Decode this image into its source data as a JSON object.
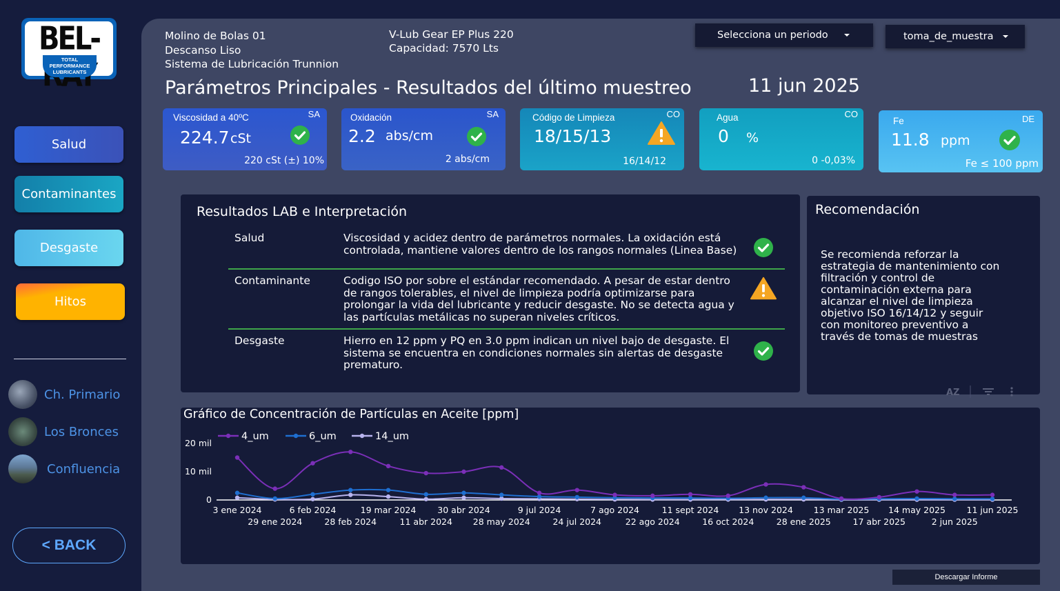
{
  "logo": {
    "brand": "BEL-RAY",
    "tagline_1": "TOTAL",
    "tagline_2": "PERFORMANCE",
    "tagline_3": "LUBRICANTS"
  },
  "sidebar": {
    "nav": [
      {
        "label": "Salud",
        "color": "#2f5fd2"
      },
      {
        "label": "Contaminantes",
        "color": "#1794b6"
      },
      {
        "label": "Desgaste",
        "color": "#5cc7ec"
      },
      {
        "label": "Hitos",
        "color": "#ffb300"
      }
    ],
    "sites": [
      {
        "label": "Ch. Primario"
      },
      {
        "label": "Los Bronces"
      },
      {
        "label": "Confluencia"
      }
    ],
    "back_label": "< BACK"
  },
  "header": {
    "equipment": "Molino de Bolas 01",
    "component": "Descanso Liso",
    "system": "Sistema de Lubricación Trunnion",
    "product": "V-Lub Gear EP Plus 220",
    "capacity": "Capacidad: 7570 Lts",
    "period_select": "Selecciona un periodo",
    "sample_select": "toma_de_muestra",
    "title": "Parámetros Principales - Resultados del último muestreo",
    "date": "11 jun 2025"
  },
  "kpis": [
    {
      "label": "Viscosidad a 40ºC",
      "tag": "SA",
      "value": "224.7",
      "unit": "cSt",
      "ref": "220 cSt (±) 10%",
      "status": "ok"
    },
    {
      "label": "Oxidación",
      "tag": "SA",
      "value": "2.2",
      "unit": "abs/cm",
      "ref": "2 abs/cm",
      "status": "ok"
    },
    {
      "label": "Código de Limpieza",
      "tag": "CO",
      "value": "18/15/13",
      "unit": "",
      "ref": "16/14/12",
      "status": "warning"
    },
    {
      "label": "Agua",
      "tag": "CO",
      "value": "0",
      "unit": "%",
      "ref": "0 -0,03%",
      "status": "none"
    },
    {
      "label": "Fe",
      "tag": "DE",
      "value": "11.8",
      "unit": "ppm",
      "ref": "Fe ≤ 100 ppm",
      "status": "ok"
    }
  ],
  "lab": {
    "title": "Resultados LAB e Interpretación",
    "rows": [
      {
        "label": "Salud",
        "lines": [
          "Viscosidad y acidez dentro de parámetros normales. La oxidación está",
          "controlada, mantiene valores dentro de los rangos normales (Linea Base)"
        ],
        "status": "ok"
      },
      {
        "label": "Contaminante",
        "lines": [
          "Codigo ISO por sobre el estándar recomendado. A pesar de estar dentro",
          "de rangos tolerables, el nivel de limpieza podría optimizarse para",
          "prolongar la vida del lubricante y reducir desgaste. No se detecta agua y",
          "las partículas metálicas no superan niveles críticos."
        ],
        "status": "warning"
      },
      {
        "label": "Desgaste",
        "lines": [
          "Hierro en 12 ppm y PQ en 3.0 ppm indican un nivel bajo de desgaste. El",
          "sistema se encuentra en condiciones normales sin alertas de desgaste",
          "prematuro."
        ],
        "status": "ok"
      }
    ]
  },
  "recommendation": {
    "title": "Recomendación",
    "lines": [
      "Se recomienda reforzar la",
      "estrategia de mantenimiento con",
      "filtración y control de",
      "contaminación externa para",
      "alcanzar el nivel de limpieza",
      "objetivo ISO 16/14/12 y seguir",
      "con monitoreo preventivo a",
      "través de tomas de muestras"
    ],
    "toolbar": [
      "sort-az-icon",
      "filter-icon",
      "more-icon"
    ]
  },
  "chart_data": {
    "type": "line",
    "title": "Gráfico de Concentración de Partículas en Aceite [ppm]",
    "x": [
      "3 ene 2024",
      "29 ene 2024",
      "6 feb 2024",
      "28 feb 2024",
      "19 mar 2024",
      "11 abr 2024",
      "30 abr 2024",
      "28 may 2024",
      "9 jul 2024",
      "24 jul 2024",
      "7 ago 2024",
      "22 ago 2024",
      "11 sept 2024",
      "16 oct 2024",
      "13 nov 2024",
      "28 ene 2025",
      "13 mar 2025",
      "17 abr 2025",
      "14 may 2025",
      "2 jun 2025",
      "11 jun 2025"
    ],
    "y_ticks": [
      "0",
      "10 mil",
      "20 mil"
    ],
    "ylim": [
      0,
      20000
    ],
    "series": [
      {
        "name": "4_um",
        "color": "#7b2fb8",
        "values": [
          15000,
          4000,
          13000,
          17000,
          12000,
          9500,
          10000,
          11500,
          2500,
          3500,
          1800,
          1500,
          2000,
          1500,
          5500,
          4500,
          500,
          1000,
          3000,
          1800,
          1800
        ]
      },
      {
        "name": "6_um",
        "color": "#1f6fd1",
        "values": [
          2500,
          500,
          2000,
          3500,
          3500,
          2000,
          2500,
          1800,
          1200,
          1000,
          800,
          700,
          700,
          600,
          800,
          800,
          300,
          400,
          500,
          400,
          400
        ]
      },
      {
        "name": "14_um",
        "color": "#b8b4ee",
        "values": [
          800,
          200,
          300,
          1800,
          1200,
          300,
          800,
          500,
          400,
          300,
          200,
          150,
          150,
          150,
          200,
          200,
          100,
          100,
          100,
          100,
          100
        ]
      }
    ],
    "legend": "top-left",
    "grid": false
  },
  "download_label": "Descargar Informe"
}
